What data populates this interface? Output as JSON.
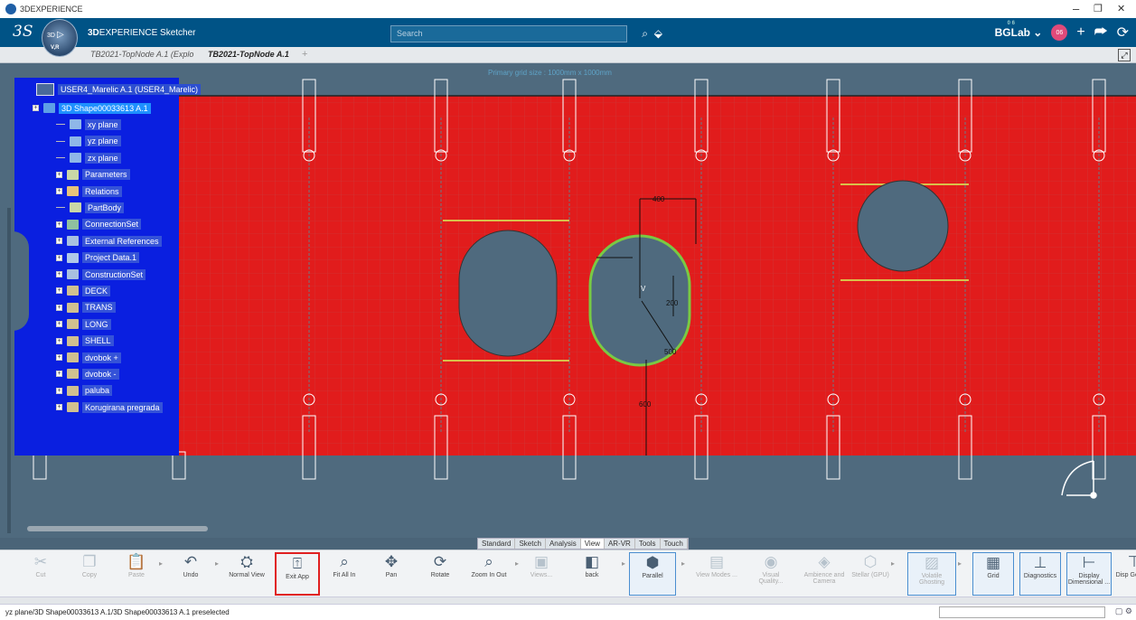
{
  "window": {
    "title": "3DEXPERIENCE",
    "controls": [
      "–",
      "❐",
      "✕"
    ]
  },
  "header": {
    "brand": "3DS",
    "app_name_bold": "3D",
    "app_name_rest": "EXPERIENCE Sketcher",
    "compass_label": "3D",
    "compass_version": "V,R",
    "search_placeholder": "Search",
    "user": "BGLab",
    "user_small": "0 6",
    "avatar_initials": "06"
  },
  "tabs": [
    {
      "label": "TB2021-TopNode A.1 (Explo",
      "active": false
    },
    {
      "label": "TB2021-TopNode A.1",
      "active": true
    }
  ],
  "viewport": {
    "grid_note": "Primary grid size : 1000mm x 1000mm",
    "dimensions": [
      "400",
      "200",
      "500",
      "600"
    ],
    "cursor_label": "V",
    "bg_color": "#4f6a7e",
    "plate_color": "#e11c1c",
    "highlight_color": "#7ac943"
  },
  "tree": {
    "root": "USER4_Marelic A.1 (USER4_Marelic)",
    "items": [
      {
        "label": "3D Shape00033613 A.1",
        "selected": true
      },
      {
        "label": "xy plane"
      },
      {
        "label": "yz plane"
      },
      {
        "label": "zx plane"
      },
      {
        "label": "Parameters"
      },
      {
        "label": "Relations"
      },
      {
        "label": "PartBody"
      },
      {
        "label": "ConnectionSet"
      },
      {
        "label": "External References"
      },
      {
        "label": "Project Data.1"
      },
      {
        "label": "ConstructionSet"
      },
      {
        "label": "DECK"
      },
      {
        "label": "TRANS"
      },
      {
        "label": "LONG"
      },
      {
        "label": "SHELL"
      },
      {
        "label": "dvobok +"
      },
      {
        "label": "dvobok -"
      },
      {
        "label": "paluba"
      },
      {
        "label": "Korugirana pregrada"
      }
    ]
  },
  "widget_tabs": [
    "Standard",
    "Sketch",
    "Analysis",
    "View",
    "AR-VR",
    "Tools",
    "Touch"
  ],
  "widget_tabs_active": "View",
  "toolbar": [
    {
      "label": "Cut",
      "icon": "scissors-icon",
      "disabled": true
    },
    {
      "label": "Copy",
      "icon": "copy-icon",
      "disabled": true
    },
    {
      "label": "Paste",
      "icon": "paste-icon",
      "disabled": true
    },
    {
      "label": "Undo",
      "icon": "undo-icon"
    },
    {
      "label": "Normal View",
      "icon": "normal-view-icon"
    },
    {
      "label": "Exit App",
      "icon": "exit-app-icon",
      "highlighted": true
    },
    {
      "label": "Fit All In",
      "icon": "fit-all-in-icon"
    },
    {
      "label": "Pan",
      "icon": "pan-icon"
    },
    {
      "label": "Rotate",
      "icon": "rotate-icon"
    },
    {
      "label": "Zoom In Out",
      "icon": "zoom-icon"
    },
    {
      "label": "Views...",
      "icon": "views-icon",
      "disabled": true
    },
    {
      "label": "back",
      "icon": "back-view-icon"
    },
    {
      "label": "Parallel",
      "icon": "parallel-icon",
      "boxed": true
    },
    {
      "label": "View Modes ...",
      "icon": "view-modes-icon",
      "disabled": true
    },
    {
      "label": "Visual Quality...",
      "icon": "visual-quality-icon",
      "disabled": true
    },
    {
      "label": "Ambience and Camera",
      "icon": "ambience-icon",
      "disabled": true
    },
    {
      "label": "Stellar (GPU)",
      "icon": "stellar-icon",
      "disabled": true
    },
    {
      "label": "Volatile Ghosting",
      "icon": "volatile-ghosting-icon",
      "disabled": true,
      "boxed": true
    },
    {
      "label": "Grid",
      "icon": "grid-icon",
      "boxed": true
    },
    {
      "label": "Diagnostics",
      "icon": "diagnostics-icon",
      "boxed": true
    },
    {
      "label": "Display Dimensional ...",
      "icon": "display-dimensional-icon",
      "boxed": true
    },
    {
      "label": "Disp Geomet",
      "icon": "display-geometry-icon"
    }
  ],
  "status": {
    "text": "yz plane/3D Shape00033613 A.1/3D Shape00033613 A.1 preselected"
  }
}
